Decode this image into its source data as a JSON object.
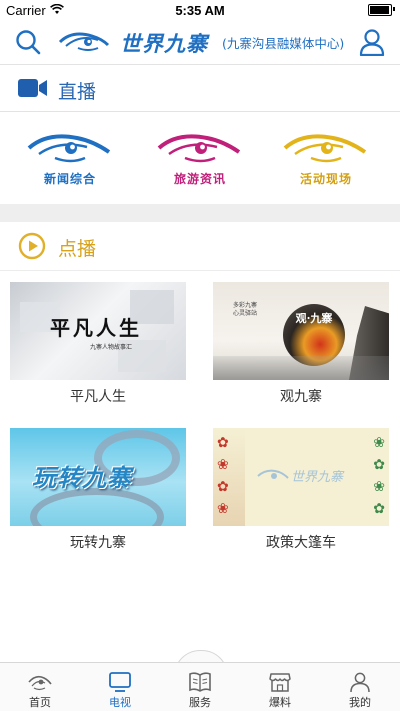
{
  "status_bar": {
    "carrier": "Carrier",
    "time": "5:35 AM"
  },
  "header": {
    "logo_text": "世界九寨",
    "subtitle": "(九寨沟县融媒体中心)"
  },
  "live": {
    "title": "直播",
    "items": [
      {
        "label": "新闻综合",
        "color": "#1f6fc2"
      },
      {
        "label": "旅游资讯",
        "color": "#c01f7a"
      },
      {
        "label": "活动现场",
        "color": "#e3b41a"
      }
    ]
  },
  "vod": {
    "title": "点播",
    "videos": [
      {
        "caption": "平凡人生",
        "thumb_text": "平凡人生",
        "thumb_sub": "九寨人物故事汇"
      },
      {
        "caption": "观九寨",
        "thumb_text": "观·九寨",
        "thumb_sub": "多彩九寨 心灵驿站"
      },
      {
        "caption": "玩转九寨",
        "thumb_text": "玩转九寨"
      },
      {
        "caption": "政策大篷车",
        "thumb_text": "世界九寨"
      }
    ]
  },
  "tabbar": {
    "tabs": [
      {
        "label": "首页"
      },
      {
        "label": "电视"
      },
      {
        "label": "服务"
      },
      {
        "label": "爆料"
      },
      {
        "label": "我的"
      }
    ],
    "active_color": "#1f6fc2"
  }
}
